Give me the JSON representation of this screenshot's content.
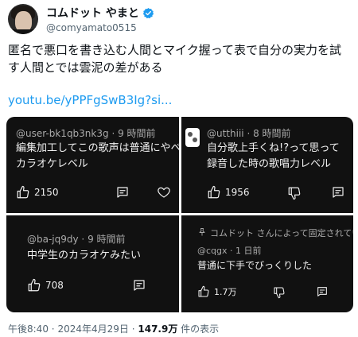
{
  "author": {
    "display_name": "コムドット やまと",
    "handle": "@comyamato0515"
  },
  "tweet": {
    "text": "匿名で悪口を書き込む人間とマイク握って表で自分の実力を試す人間とでは雲泥の差がある",
    "link": "youtu.be/yPPFgSwB3Ig?si..."
  },
  "comments": [
    {
      "user": "@user-bk1qb3nk3g",
      "time": "9 時間前",
      "line1": "編集加工してこの歌声は普通にやべー",
      "line2": "カラオケレベル",
      "likes": "2150"
    },
    {
      "user": "@utthiii",
      "time": "8 時間前",
      "line1": "自分歌上手くね!?って思って",
      "line2": "録音した時の歌唱力レベル",
      "likes": "1956"
    },
    {
      "user": "@ba-jq9dy",
      "time": "9 時間前",
      "line1": "中学生のカラオケみたい",
      "likes": "708"
    },
    {
      "pinned_label": "コムドット さんによって固定されています",
      "user": "@cqgx",
      "time": "1 日前",
      "line1": "普通に下手でびっくりした",
      "likes": "1.7万"
    }
  ],
  "footer": {
    "time": "午後8:40",
    "date": "2024年4月29日",
    "views": "147.9万",
    "views_suffix": "件の表示",
    "separator": "·"
  },
  "colors": {
    "link": "#1d9bf0",
    "verified": "#1d9bf0",
    "card_bg": "#111111"
  },
  "icons": [
    "verified-icon",
    "thumbs-up-icon",
    "thumbs-down-icon",
    "reply-icon",
    "heart-icon",
    "pin-icon"
  ]
}
